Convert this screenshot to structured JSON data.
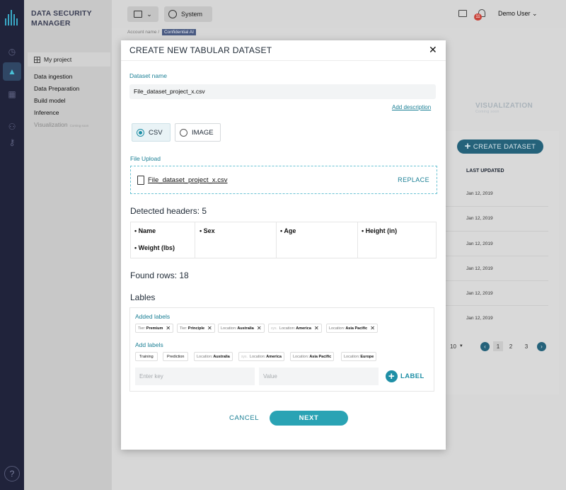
{
  "app": {
    "brand": "DATA SECURITY MANAGER"
  },
  "nav": {
    "project": "My project",
    "items": [
      {
        "label": "Data ingestion"
      },
      {
        "label": "Data Preparation"
      },
      {
        "label": "Build model"
      },
      {
        "label": "Inference"
      },
      {
        "label": "Visualization",
        "tag": "Coming soon"
      }
    ]
  },
  "topbar": {
    "system_label": "System",
    "notifications": "11",
    "user": "Demo User"
  },
  "breadcrumb": {
    "account_label": "Account name",
    "chip": "Confidential AI"
  },
  "background": {
    "tab_visualization": "VISUALIZATION",
    "tab_visualization_sub": "Coming soon",
    "create_dataset": "CREATE DATASET",
    "col_last_updated": "LAST UPDATED",
    "dates": [
      "Jan 12, 2019",
      "Jan 12, 2019",
      "Jan 12, 2019",
      "Jan 12, 2019",
      "Jan 12, 2019",
      "Jan 12, 2019"
    ],
    "page_size": "10",
    "pages": [
      "1",
      "2",
      "3"
    ]
  },
  "modal": {
    "title": "CREATE NEW TABULAR DATASET",
    "dataset_name_label": "Dataset name",
    "dataset_name_value": "File_dataset_project_x.csv",
    "add_description": "Add description",
    "type_options": [
      {
        "label": "CSV",
        "selected": true
      },
      {
        "label": "IMAGE",
        "selected": false
      }
    ],
    "file_upload_label": "File Upload",
    "file_name": "File_dataset_project_x.csv",
    "replace": "REPLACE",
    "detected_headers": "Detected headers: 5",
    "headers": [
      "Name",
      "Sex",
      "Age",
      "Height (in)",
      "Weight (lbs)"
    ],
    "found_rows": "Found rows: 18",
    "labels_title": "Lables",
    "added_labels_title": "Added labels",
    "added_labels": [
      {
        "key": "Tier:",
        "value": "Premium",
        "sys": ""
      },
      {
        "key": "Tier:",
        "value": "Principle",
        "sys": ""
      },
      {
        "key": "Location:",
        "value": "Australia",
        "sys": ""
      },
      {
        "key": "Location:",
        "value": "America",
        "sys": "sys."
      },
      {
        "key": "Location:",
        "value": "Asia Pacific",
        "sys": ""
      }
    ],
    "add_labels_title": "Add labels",
    "suggested_labels": [
      {
        "key": "",
        "value": "Training",
        "sys": ""
      },
      {
        "key": "",
        "value": "Prediction",
        "sys": ""
      },
      {
        "key": "Location:",
        "value": "Australia",
        "sys": ""
      },
      {
        "key": "Location:",
        "value": "America",
        "sys": "sys."
      },
      {
        "key": "Location:",
        "value": "Asia Pacific",
        "sys": ""
      },
      {
        "key": "Location:",
        "value": "Europe",
        "sys": ""
      }
    ],
    "key_placeholder": "Enter key",
    "value_placeholder": "Value",
    "add_label_button": "LABEL",
    "cancel": "CANCEL",
    "next": "NEXT"
  },
  "colors": {
    "accent": "#1f8fa6",
    "rail": "#20233b",
    "badge": "#c9453c"
  }
}
